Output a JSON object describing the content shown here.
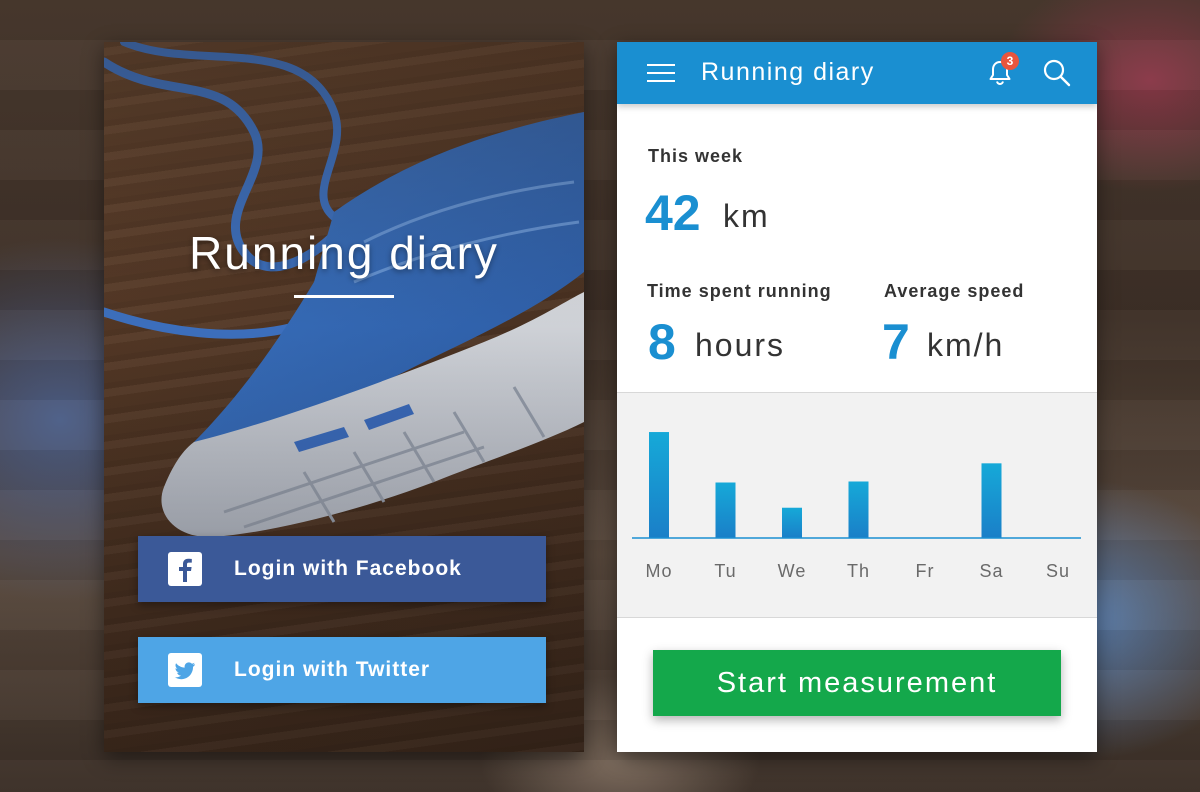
{
  "login_screen": {
    "title": "Running diary",
    "facebook_button": {
      "label": "Login with Facebook",
      "icon": "facebook-icon",
      "color": "#3b5998"
    },
    "twitter_button": {
      "label": "Login with Twitter",
      "icon": "twitter-icon",
      "color": "#4ea5e6"
    }
  },
  "dashboard_screen": {
    "appbar": {
      "title": "Running diary",
      "menu_icon": "hamburger-menu-icon",
      "notification_icon": "bell-icon",
      "notification_count": "3",
      "search_icon": "search-icon",
      "color": "#1a8fd1"
    },
    "this_week": {
      "label": "This week",
      "value": "42",
      "unit": "km"
    },
    "time_spent": {
      "label": "Time spent running",
      "value": "8",
      "unit": "hours"
    },
    "average_speed": {
      "label": "Average speed",
      "value": "7",
      "unit": "km/h"
    },
    "start_button": {
      "label": "Start measurement",
      "color": "#14a84b"
    }
  },
  "chart_data": {
    "type": "bar",
    "categories": [
      "Mo",
      "Tu",
      "We",
      "Th",
      "Fr",
      "Sa",
      "Su"
    ],
    "values": [
      10.5,
      5.5,
      3,
      5.6,
      0,
      7.4,
      0
    ],
    "ylim": [
      0,
      11
    ],
    "grid": false,
    "bar_color": "#1a8fd1"
  }
}
